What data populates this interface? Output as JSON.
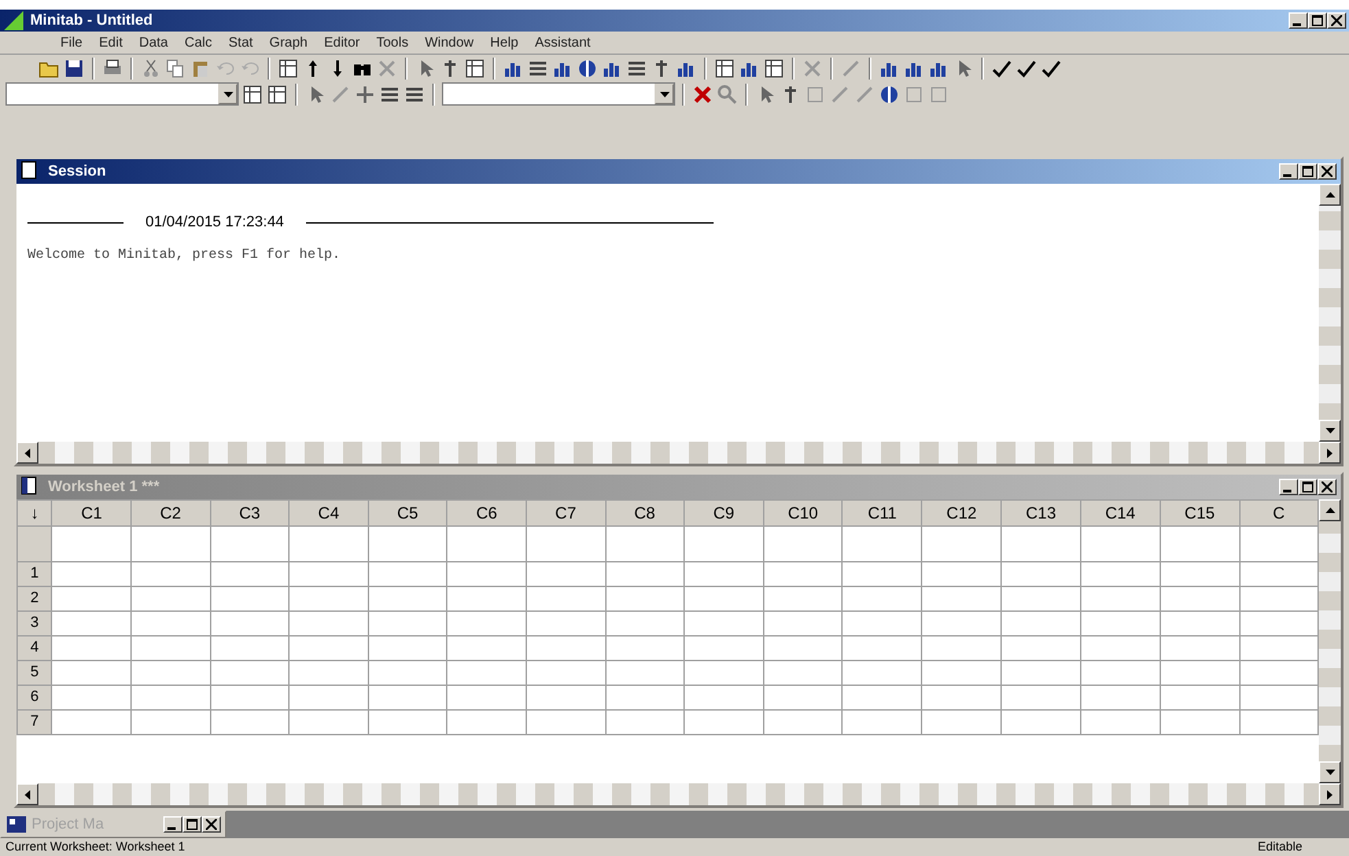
{
  "window": {
    "title": "Minitab - Untitled"
  },
  "menu": [
    "File",
    "Edit",
    "Data",
    "Calc",
    "Stat",
    "Graph",
    "Editor",
    "Tools",
    "Window",
    "Help",
    "Assistant"
  ],
  "session": {
    "title": "Session",
    "timestamp": "01/04/2015 17:23:44",
    "message": "Welcome to Minitab, press F1 for help."
  },
  "worksheet": {
    "title": "Worksheet 1 ***",
    "corner": "↓",
    "columns": [
      "C1",
      "C2",
      "C3",
      "C4",
      "C5",
      "C6",
      "C7",
      "C8",
      "C9",
      "C10",
      "C11",
      "C12",
      "C13",
      "C14",
      "C15",
      "C"
    ],
    "rows": [
      "1",
      "2",
      "3",
      "4",
      "5",
      "6",
      "7"
    ]
  },
  "minimized_window": {
    "title": "Project Ma"
  },
  "status_bar": {
    "left": "Current Worksheet: Worksheet 1",
    "right": "Editable"
  }
}
